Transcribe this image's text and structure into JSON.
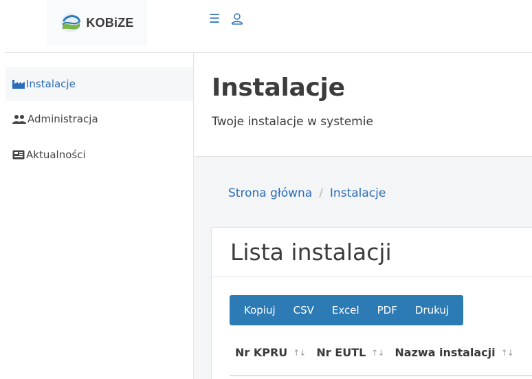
{
  "brand": {
    "name": "KOBiZE",
    "accent": "#2a6db8",
    "button_bg": "#2d7bb4"
  },
  "topbar": {
    "menu_icon": "hamburger-icon",
    "user_icon": "user-icon"
  },
  "sidebar": {
    "items": [
      {
        "label": "Instalacje",
        "icon": "factory-icon",
        "active": true
      },
      {
        "label": "Administracja",
        "icon": "users-icon",
        "active": false
      },
      {
        "label": "Aktualności",
        "icon": "newspaper-icon",
        "active": false
      }
    ]
  },
  "header": {
    "title": "Instalacje",
    "subtitle": "Twoje instalacje w systemie"
  },
  "breadcrumb": {
    "home": "Strona główna",
    "separator": "/",
    "current": "Instalacje"
  },
  "card": {
    "title": "Lista instalacji",
    "buttons": [
      "Kopiuj",
      "CSV",
      "Excel",
      "PDF",
      "Drukuj"
    ],
    "columns": [
      {
        "label": "Nr KPRU",
        "sort": "↑↓"
      },
      {
        "label": "Nr EUTL",
        "sort": "↑↓"
      },
      {
        "label": "Nazwa instalacji",
        "sort": "↑↓"
      }
    ]
  }
}
